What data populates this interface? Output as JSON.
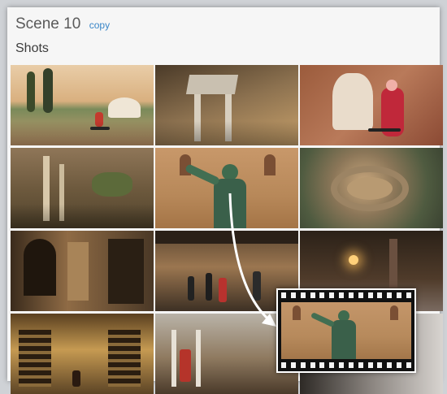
{
  "header": {
    "title": "Scene 10",
    "copy_label": "copy"
  },
  "section": {
    "label": "Shots"
  },
  "shots": [
    {
      "id": 1,
      "subject": "fountain-square-cyclist"
    },
    {
      "id": 2,
      "subject": "forum-ruins-aerial"
    },
    {
      "id": 3,
      "subject": "fountain-red-cyclist"
    },
    {
      "id": 4,
      "subject": "forum-ruins-columns"
    },
    {
      "id": 5,
      "subject": "augustus-statue"
    },
    {
      "id": 6,
      "subject": "colosseum-aerial"
    },
    {
      "id": 7,
      "subject": "arched-interior"
    },
    {
      "id": 8,
      "subject": "street-cafe-crowd"
    },
    {
      "id": 9,
      "subject": "night-street"
    },
    {
      "id": 10,
      "subject": "niche-catacomb"
    },
    {
      "id": 11,
      "subject": "columned-corridor"
    },
    {
      "id": 12,
      "subject": "dark-gradient"
    }
  ],
  "drag": {
    "source_shot": 5,
    "icon": "filmstrip-icon"
  },
  "colors": {
    "link": "#3a86c8",
    "panel": "#f6f6f6",
    "arrow": "#ffffff"
  }
}
